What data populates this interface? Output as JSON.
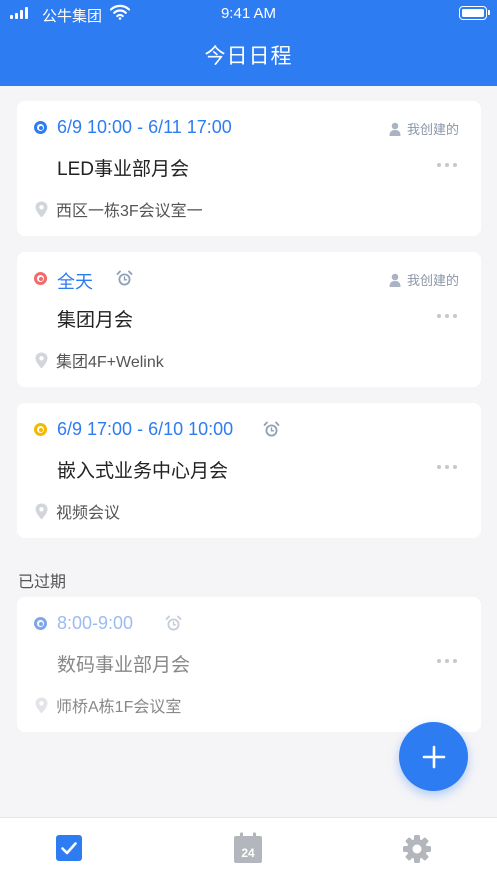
{
  "status_bar": {
    "carrier": "公牛集团",
    "time": "9:41 AM"
  },
  "header": {
    "title": "今日日程"
  },
  "events": [
    {
      "time": "6/9 10:00 - 6/11 17:00",
      "title": "LED事业部月会",
      "location": "西区一栋3F会议室一",
      "creator": "我创建的",
      "dot_color": "#2d7cf2",
      "alarm": false
    },
    {
      "time": "全天",
      "title": "集团月会",
      "location": "集团4F+Welink",
      "creator": "我创建的",
      "dot_color": "#f26a6a",
      "alarm": true
    },
    {
      "time": "6/9 17:00 - 6/10 10:00",
      "title": "嵌入式业务中心月会",
      "location": "视频会议",
      "creator": "",
      "dot_color": "#f5b800",
      "alarm": true
    }
  ],
  "expired": {
    "label": "已过期",
    "events": [
      {
        "time": "8:00-9:00",
        "title": "数码事业部月会",
        "location": "师桥A栋1F会议室",
        "dot_color": "#7da6ec",
        "alarm": true
      }
    ]
  },
  "fab": {
    "icon": "plus-icon"
  },
  "tabbar": {
    "tabs": [
      {
        "icon": "checkbox-icon",
        "active": true
      },
      {
        "icon": "calendar-icon",
        "label": "24",
        "active": false
      },
      {
        "icon": "gear-icon",
        "active": false
      }
    ]
  },
  "colors": {
    "primary": "#2d7cf2",
    "background": "#f5f5f7"
  }
}
